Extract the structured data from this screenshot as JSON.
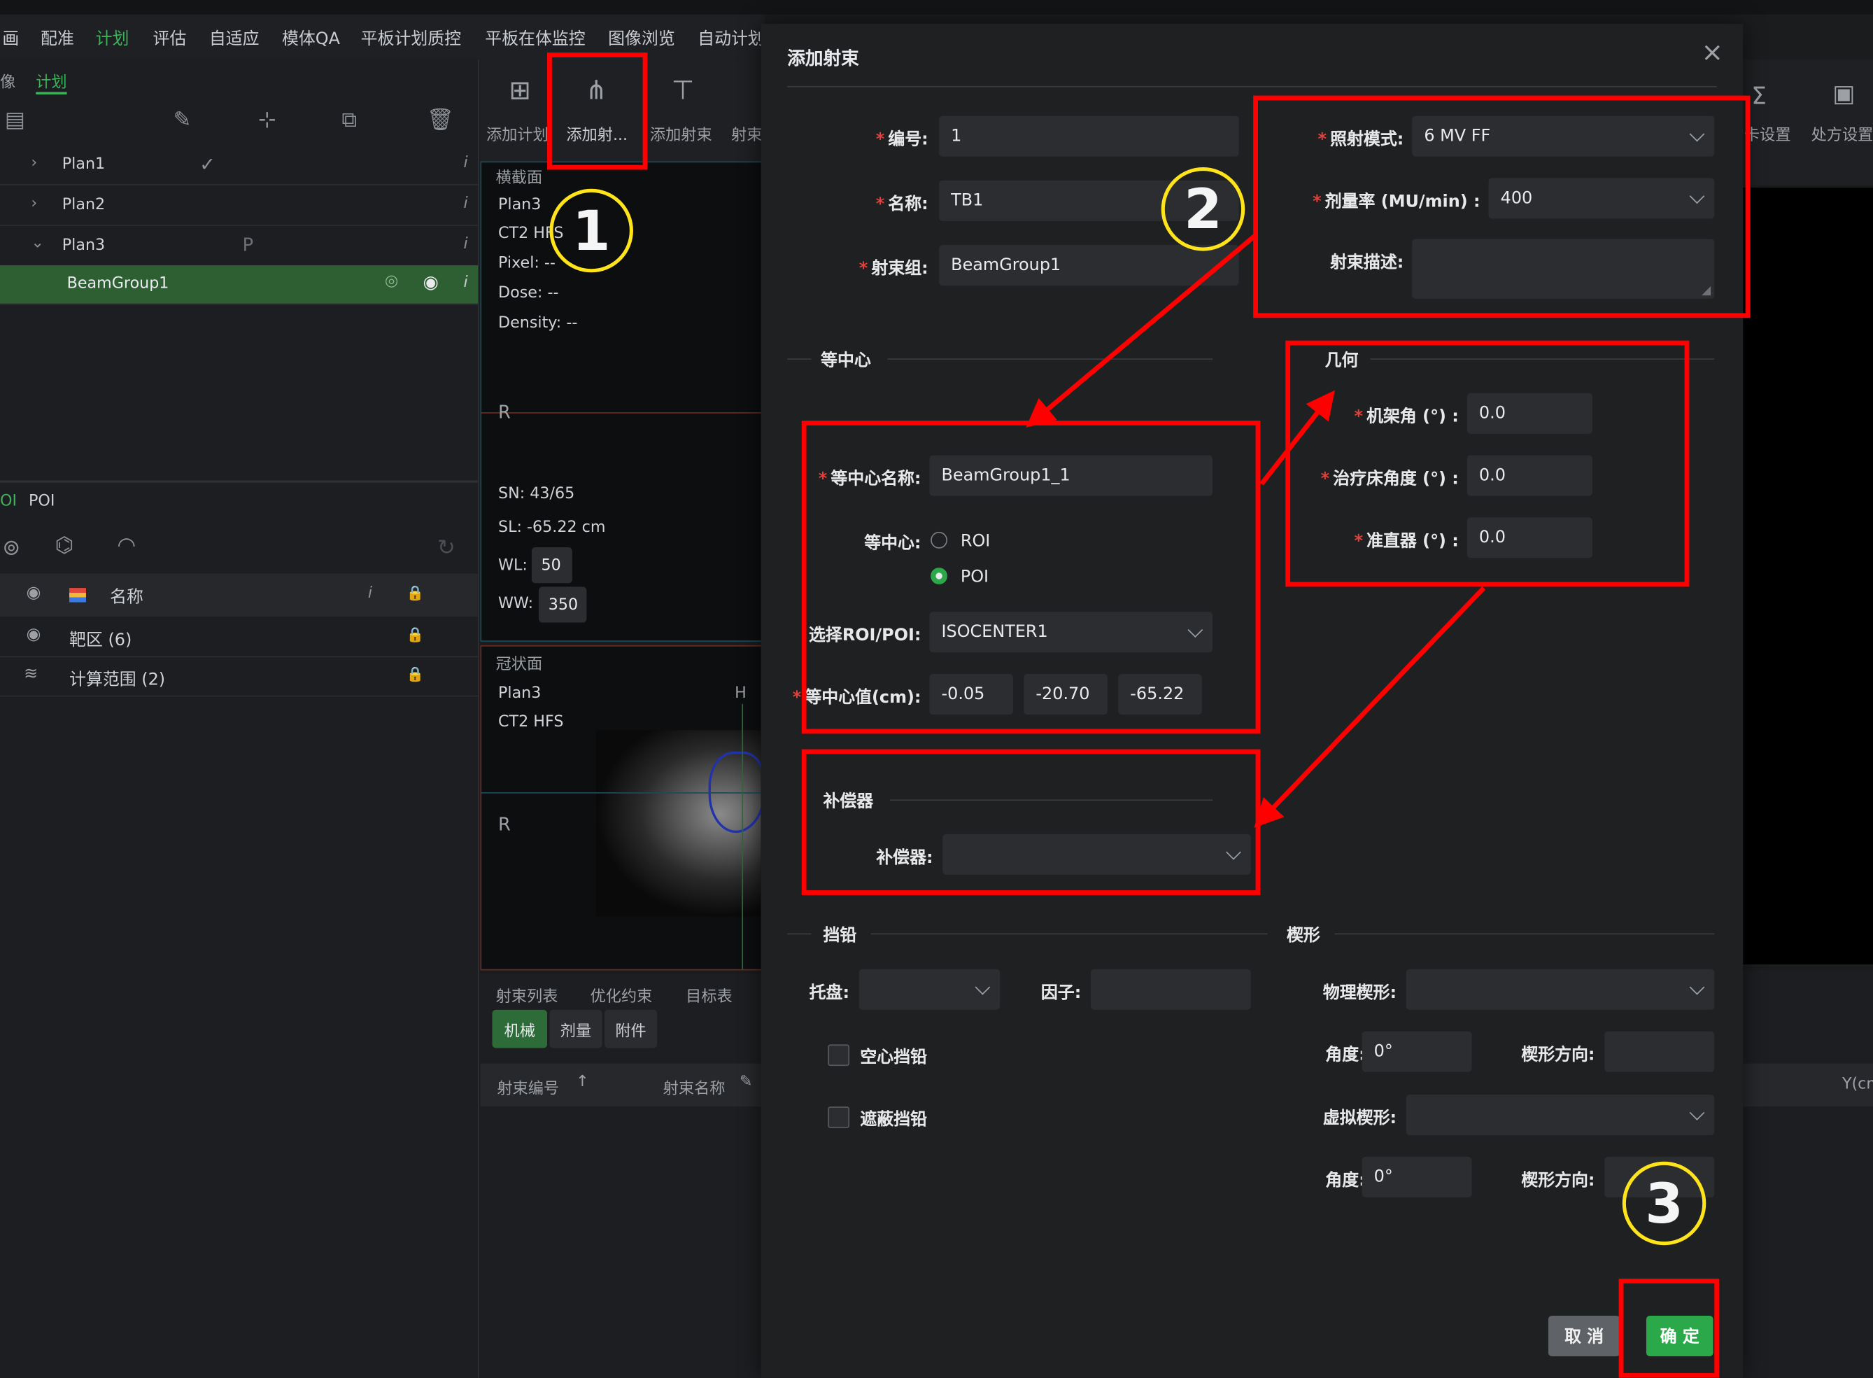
{
  "menu_bar": {
    "items": [
      "画",
      "配准",
      "计划",
      "评估",
      "自适应",
      "模体QA",
      "平板计划质控",
      "平板在体监控",
      "图像浏览",
      "自动计划"
    ]
  },
  "left_panel": {
    "tabs": [
      "像",
      "计划"
    ],
    "plans": [
      {
        "label": "Plan1"
      },
      {
        "label": "Plan2"
      },
      {
        "label": "Plan3"
      }
    ],
    "beam_group": "BeamGroup1",
    "roi_tabs": [
      "OI",
      "POI"
    ],
    "table_header": "名称",
    "roi_rows": [
      "靶区 (6)",
      "计算范围 (2)"
    ]
  },
  "toolbar": {
    "buttons": [
      "添加计划",
      "添加射...",
      "添加射束",
      "射束"
    ],
    "right_buttons": [
      "卡设置",
      "处方设置"
    ]
  },
  "view_axial": {
    "tab": "横截面",
    "info": [
      "Plan3",
      "CT2 HFS",
      "Pixel: --",
      "Dose: --",
      "Density: --"
    ],
    "orient": "R",
    "sn": "SN: 43/65",
    "sl": "SL: -65.22 cm",
    "wl_label": "WL:",
    "wl_value": "50",
    "ww_label": "WW:",
    "ww_value": "350"
  },
  "view_coronal": {
    "tab": "冠状面",
    "info": [
      "Plan3",
      "CT2 HFS"
    ],
    "orient_left": "R",
    "orient_top": "H"
  },
  "bottom_panel": {
    "tabs": [
      "射束列表",
      "优化约束",
      "目标表"
    ],
    "subtabs": [
      "机械",
      "剂量",
      "附件"
    ],
    "columns": [
      "射束编号",
      "射束名称"
    ],
    "right_col": "Y(cm"
  },
  "dialog": {
    "title": "添加射束",
    "close": "×",
    "number_label": "编号:",
    "number_value": "1",
    "name_label": "名称:",
    "name_value": "TB1",
    "group_label": "射束组:",
    "group_value": "BeamGroup1",
    "mode_label": "照射模式:",
    "mode_value": "6 MV FF",
    "rate_label": "剂量率 (MU/min) :",
    "rate_value": "400",
    "desc_label": "射束描述:",
    "iso_section": "等中心",
    "iso_name_label": "等中心名称:",
    "iso_name_value": "BeamGroup1_1",
    "iso_type_label": "等中心:",
    "iso_options": [
      "ROI",
      "POI"
    ],
    "iso_selected": "POI",
    "sel_label": "选择ROI/POI:",
    "sel_value": "ISOCENTER1",
    "iso_val_label": "等中心值(cm):",
    "iso_values": [
      "-0.05",
      "-20.70",
      "-65.22"
    ],
    "geo_section": "几何",
    "gantry_label": "机架角 (°) :",
    "gantry_value": "0.0",
    "couch_label": "治疗床角度 (°) :",
    "couch_value": "0.0",
    "coll_label": "准直器 (°) :",
    "coll_value": "0.0",
    "comp_section": "补偿器",
    "comp_label": "补偿器:",
    "block_section": "挡铅",
    "tray_label": "托盘:",
    "factor_label": "因子:",
    "hollow_label": "空心挡铅",
    "shield_label": "遮蔽挡铅",
    "wedge_section": "楔形",
    "phys_wedge_label": "物理楔形:",
    "angle_label": "角度:",
    "angle_value": "0°",
    "wedge_dir_label": "楔形方向:",
    "virt_wedge_label": "虚拟楔形:",
    "angle2_label": "角度:",
    "angle2_value": "0°",
    "wedge_dir2_label": "楔形方向:",
    "cancel": "取 消",
    "ok": "确 定"
  },
  "annotations": [
    "1",
    "2",
    "3"
  ],
  "colors": {
    "accent_green": "#2aa84a",
    "annotation_red": "#ff0000",
    "annotation_yellow": "#ffe41b"
  }
}
